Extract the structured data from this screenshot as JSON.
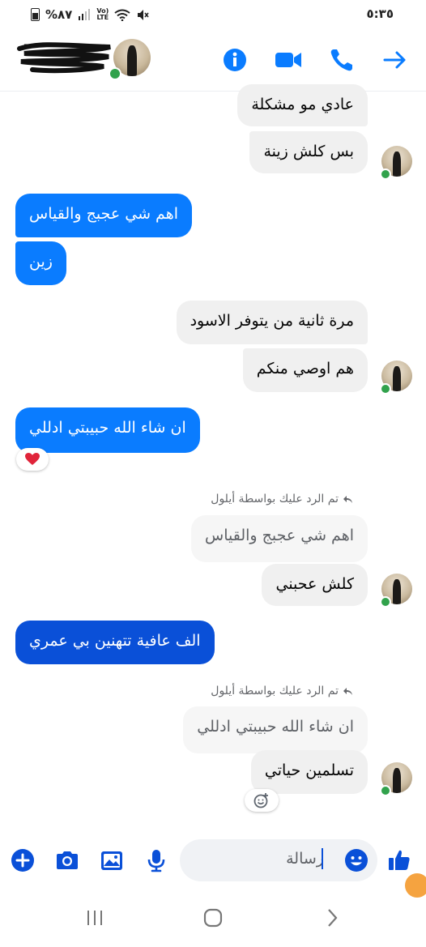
{
  "status_bar": {
    "time": "٥:٣٥",
    "battery": "%٨٧",
    "network": "LTE",
    "volte": "Vo)",
    "icons": [
      "battery-icon",
      "signal-icon",
      "wifi-icon",
      "mute-icon"
    ]
  },
  "header": {
    "contact_name_redacted": true,
    "icons": [
      "info-icon",
      "video-call-icon",
      "phone-icon",
      "back-arrow-icon"
    ]
  },
  "messages": [
    {
      "side": "received",
      "text": "عادي مو مشكلة"
    },
    {
      "side": "received",
      "text": "بس كلش زينة"
    },
    {
      "side": "sent",
      "text": "اهم شي عجبج والقياس"
    },
    {
      "side": "sent",
      "text": "زين"
    },
    {
      "side": "received",
      "text": "مرة ثانية من يتوفر الاسود"
    },
    {
      "side": "received",
      "text": "هم اوصي منكم"
    },
    {
      "side": "sent",
      "text": "ان شاء الله حبيبتي ادللي",
      "reaction": "heart"
    },
    {
      "side": "received",
      "reply_label": "تم الرد عليك بواسطة أيلول",
      "quoted": "اهم شي عجبج والقياس",
      "text": "كلش عحبني"
    },
    {
      "side": "sent",
      "text": "الف عافية  تتهنين بي عمري"
    },
    {
      "side": "received",
      "reply_label": "تم الرد عليك بواسطة أيلول",
      "quoted": "ان شاء الله حبيبتي ادللي",
      "text": "تسلمين حياتي",
      "reaction": "add-reaction"
    }
  ],
  "composer": {
    "input_value": "رسالة",
    "icons": [
      "plus-icon",
      "camera-icon",
      "gallery-icon",
      "mic-icon",
      "emoji-icon",
      "like-icon"
    ]
  },
  "colors": {
    "accent": "#0a7cff",
    "sent_bubble": "#0a7cff",
    "sent_bubble_dark": "#0a50d8",
    "received_bubble": "#f0f0f0",
    "online": "#31a24c"
  }
}
